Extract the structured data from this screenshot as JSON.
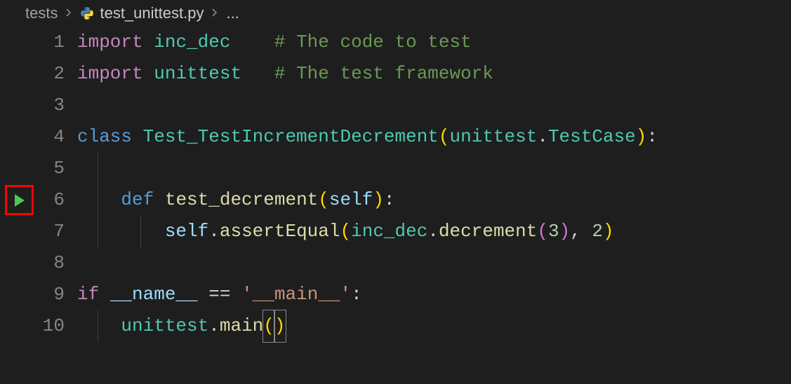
{
  "breadcrumb": {
    "folder": "tests",
    "file": "test_unittest.py",
    "trail": "..."
  },
  "lines": {
    "l1": {
      "num": "1",
      "import": "import",
      "mod": "inc_dec",
      "pad": "    ",
      "cmt": "# The code to test"
    },
    "l2": {
      "num": "2",
      "import": "import",
      "mod": "unittest",
      "pad": "   ",
      "cmt": "# The test framework"
    },
    "l3": {
      "num": "3"
    },
    "l4": {
      "num": "4",
      "class": "class",
      "name": "Test_TestIncrementDecrement",
      "lp": "(",
      "base1": "unittest",
      "dot": ".",
      "base2": "TestCase",
      "rp": ")",
      "colon": ":"
    },
    "l5": {
      "num": "5"
    },
    "l6": {
      "num": "6",
      "def": "def",
      "fn": "test_decrement",
      "lp": "(",
      "self": "self",
      "rp": ")",
      "colon": ":"
    },
    "l7": {
      "num": "7",
      "self": "self",
      "dot1": ".",
      "assert": "assertEqual",
      "lp1": "(",
      "mod": "inc_dec",
      "dot2": ".",
      "dec": "decrement",
      "lp2": "(",
      "n3": "3",
      "rp2": ")",
      "comma": ", ",
      "n2": "2",
      "rp1": ")"
    },
    "l8": {
      "num": "8"
    },
    "l9": {
      "num": "9",
      "if": "if",
      "name": "__name__",
      "eq": " == ",
      "str": "'__main__'",
      "colon": ":"
    },
    "l10": {
      "num": "10",
      "mod": "unittest",
      "dot": ".",
      "fn": "main",
      "lp": "(",
      "rp": ")"
    }
  }
}
